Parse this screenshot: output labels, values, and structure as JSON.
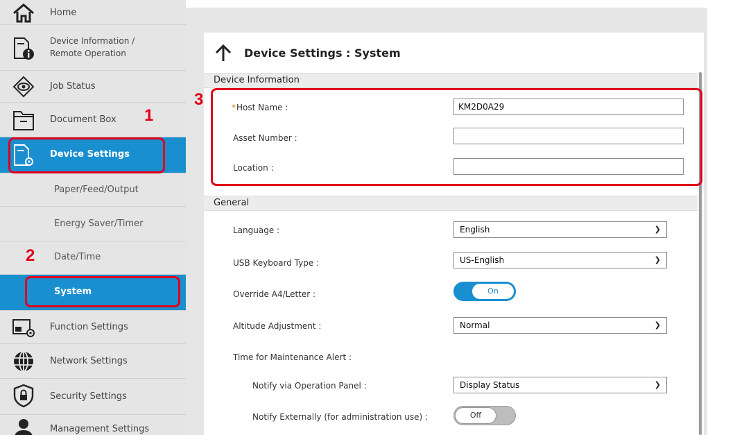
{
  "sidebar": {
    "items": [
      {
        "label": "Home"
      },
      {
        "label": "Device Information /",
        "label2": "Remote Operation"
      },
      {
        "label": "Job Status"
      },
      {
        "label": "Document Box"
      },
      {
        "label": "Device Settings"
      },
      {
        "label": "Function Settings"
      },
      {
        "label": "Network Settings"
      },
      {
        "label": "Security Settings"
      },
      {
        "label": "Management Settings"
      }
    ],
    "subitems": [
      {
        "label": "Paper/Feed/Output"
      },
      {
        "label": "Energy Saver/Timer"
      },
      {
        "label": "Date/Time"
      },
      {
        "label": "System"
      }
    ]
  },
  "main": {
    "title": "Device Settings : System",
    "device_info": {
      "header": "Device Information",
      "host_required_mark": "*",
      "host_label": "Host Name :",
      "host_value": "KM2D0A29",
      "asset_label": "Asset Number :",
      "asset_value": "",
      "location_label": "Location :",
      "location_value": ""
    },
    "general": {
      "header": "General",
      "language_label": "Language :",
      "language_value": "English",
      "usb_label": "USB Keyboard Type :",
      "usb_value": "US-English",
      "override_label": "Override A4/Letter :",
      "override_value": "On",
      "altitude_label": "Altitude Adjustment :",
      "altitude_value": "Normal",
      "maint_label": "Time for Maintenance Alert :",
      "notify_panel_label": "Notify via Operation Panel :",
      "notify_panel_value": "Display Status",
      "notify_ext_label": "Notify Externally (for administration use) :",
      "notify_ext_value": "Off"
    }
  },
  "callouts": {
    "one": "1",
    "two": "2",
    "three": "3"
  },
  "colors": {
    "accent": "#1a8fd0",
    "callout": "#e0001a"
  },
  "icons": [
    "home-icon",
    "device-info-icon",
    "job-status-icon",
    "document-box-icon",
    "device-settings-icon",
    "function-settings-icon",
    "network-settings-icon",
    "security-settings-icon",
    "management-settings-icon",
    "arrow-up-icon",
    "chevron-down-icon"
  ]
}
